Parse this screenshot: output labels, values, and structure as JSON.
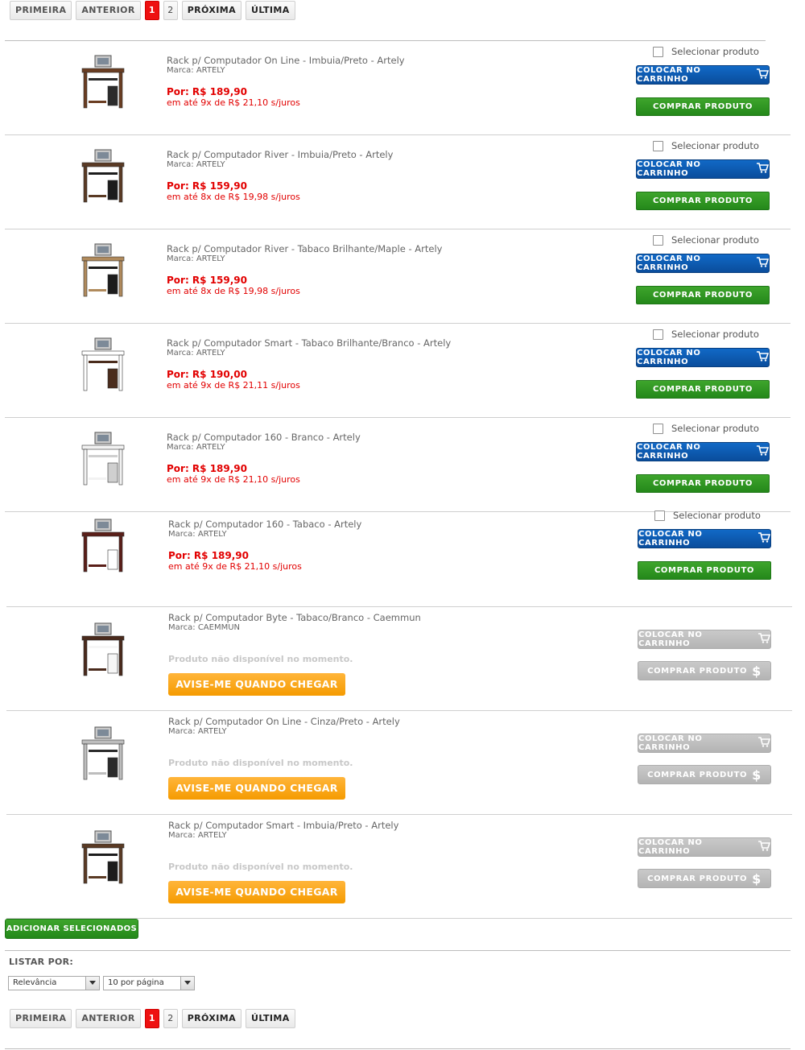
{
  "pagination": {
    "first": "PRIMEIRA",
    "previous": "ANTERIOR",
    "pages": [
      "1",
      "2"
    ],
    "active_page": "1",
    "next": "PRÓXIMA",
    "last": "ÚLTIMA"
  },
  "select_label": "Selecionar produto",
  "buttons": {
    "add_to_cart": "COLOCAR NO CARRINHO",
    "buy": "COMPRAR PRODUTO",
    "notify": "AVISE-ME QUANDO CHEGAR",
    "add_selected": "ADICIONAR SELECIONADOS"
  },
  "unavailable_text": "Produto não disponível no momento.",
  "products": [
    {
      "title": "Rack p/ Computador On Line - Imbuia/Preto - Artely",
      "brand": "Marca: ARTELY",
      "price": "Por: R$ 189,90",
      "installments": "em até 9x de R$ 21,10 s/juros",
      "available": true
    },
    {
      "title": "Rack p/ Computador River - Imbuia/Preto - Artely",
      "brand": "Marca: ARTELY",
      "price": "Por: R$ 159,90",
      "installments": "em até 8x de R$ 19,98 s/juros",
      "available": true
    },
    {
      "title": "Rack p/ Computador River - Tabaco Brilhante/Maple - Artely",
      "brand": "Marca: ARTELY",
      "price": "Por: R$ 159,90",
      "installments": "em até 8x de R$ 19,98 s/juros",
      "available": true
    },
    {
      "title": "Rack p/ Computador Smart - Tabaco Brilhante/Branco - Artely",
      "brand": "Marca: ARTELY",
      "price": "Por: R$ 190,00",
      "installments": "em até 9x de R$ 21,11 s/juros",
      "available": true
    },
    {
      "title": "Rack p/ Computador 160 - Branco - Artely",
      "brand": "Marca: ARTELY",
      "price": "Por: R$ 189,90",
      "installments": "em até 9x de R$ 21,10 s/juros",
      "available": true
    },
    {
      "title": "Rack p/ Computador 160 - Tabaco - Artely",
      "brand": "Marca: ARTELY",
      "price": "Por: R$ 189,90",
      "installments": "em até 9x de R$ 21,10 s/juros",
      "available": true
    },
    {
      "title": "Rack p/ Computador Byte - Tabaco/Branco - Caemmun",
      "brand": "Marca: CAEMMUN",
      "available": false
    },
    {
      "title": "Rack p/ Computador On Line - Cinza/Preto - Artely",
      "brand": "Marca: ARTELY",
      "available": false
    },
    {
      "title": "Rack p/ Computador Smart - Imbuia/Preto - Artely",
      "brand": "Marca: ARTELY",
      "available": false
    }
  ],
  "sorting": {
    "label": "LISTAR POR:",
    "order_value": "Relevância",
    "per_page_value": "10 por página"
  }
}
